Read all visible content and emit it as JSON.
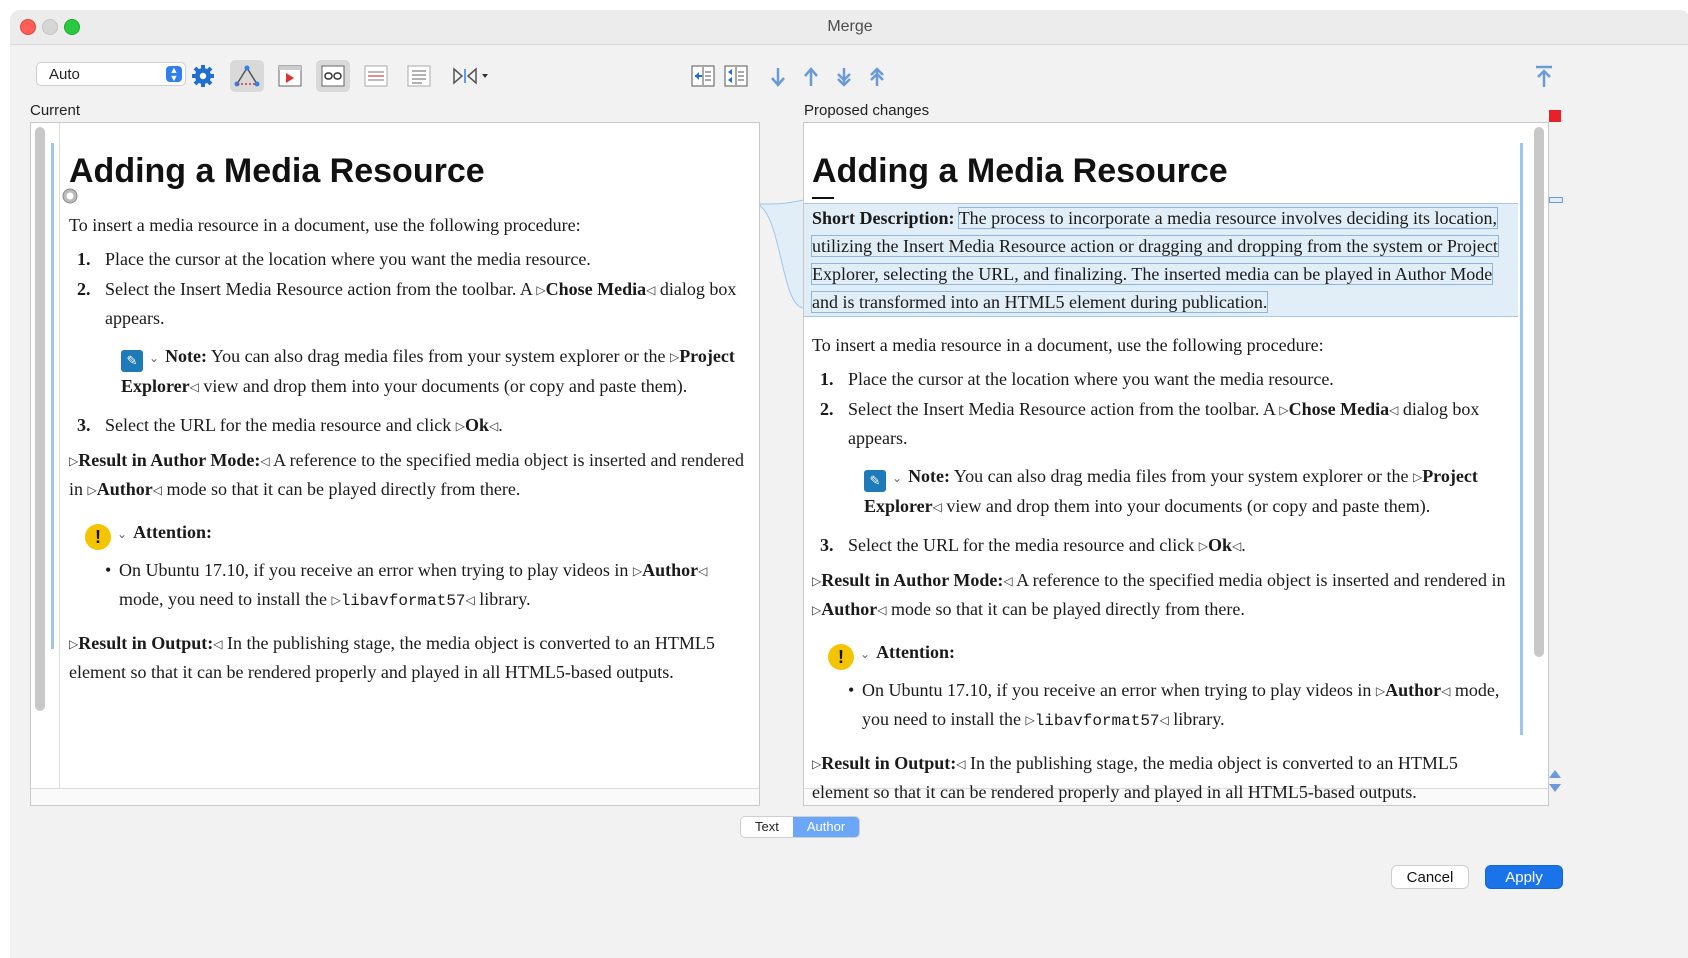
{
  "window": {
    "title": "Merge"
  },
  "toolbar": {
    "mode_value": "Auto",
    "icons": [
      "gear-icon",
      "conflict-icon",
      "next-change-icon",
      "link-icon",
      "split-icon",
      "text-icon",
      "diff-mode-icon"
    ],
    "nav_icons": [
      "copy-left-icon",
      "copy-all-icon",
      "next-change-arrow-icon",
      "prev-change-arrow-icon",
      "next-conflict-icon",
      "prev-conflict-icon",
      "first-change-icon"
    ]
  },
  "left": {
    "label": "Current",
    "title": "Adding a Media Resource",
    "intro": "To insert a media resource in a document, use the following procedure:",
    "step1": "Place the cursor at the location where you want the media resource.",
    "step2_pre": "Select the Insert Media Resource action from the toolbar. A ",
    "step2_ui": "Chose Media",
    "step2_post": " dialog box appears.",
    "note_label": "Note:",
    "note_pre": " You can also drag media files from your system explorer or the ",
    "note_ui": "Project Explorer",
    "note_post": " view and drop them into your documents (or copy and paste them).",
    "step3_pre": "Select the URL for the media resource and click ",
    "step3_ui": "Ok",
    "step3_post": ".",
    "result_author_label": "Result in Author Mode:",
    "result_author_pre": " A reference to the specified media object is inserted and rendered in ",
    "result_author_ui": "Author",
    "result_author_post": " mode so that it can be played directly from there.",
    "attention_label": "Attention:",
    "bullet_pre": "On Ubuntu 17.10, if you receive an error when trying to play videos in ",
    "bullet_ui": "Author",
    "bullet_mid": " mode, you need to install the ",
    "bullet_code": "libavformat57",
    "bullet_post": " library.",
    "result_output_label": "Result in Output:",
    "result_output_text": " In the publishing stage, the media object is converted to an HTML5 element so that it can be rendered properly and played in all HTML5-based outputs."
  },
  "right": {
    "label": "Proposed changes",
    "title": "Adding a Media Resource",
    "shortdesc_label": "Short Description:",
    "shortdesc_text": "The process to incorporate a media resource involves deciding its location, utilizing the Insert Media Resource action or dragging and dropping from the system or Project Explorer, selecting the URL, and finalizing. The inserted media can be played in Author Mode and is transformed into an HTML5 element during publication."
  },
  "view_tabs": {
    "text": "Text",
    "author": "Author"
  },
  "buttons": {
    "cancel": "Cancel",
    "apply": "Apply"
  },
  "colors": {
    "accent": "#1a73e8",
    "change_highlight": "#e1eef8",
    "conflict_marker": "#e8202a",
    "attention": "#f5c400"
  }
}
